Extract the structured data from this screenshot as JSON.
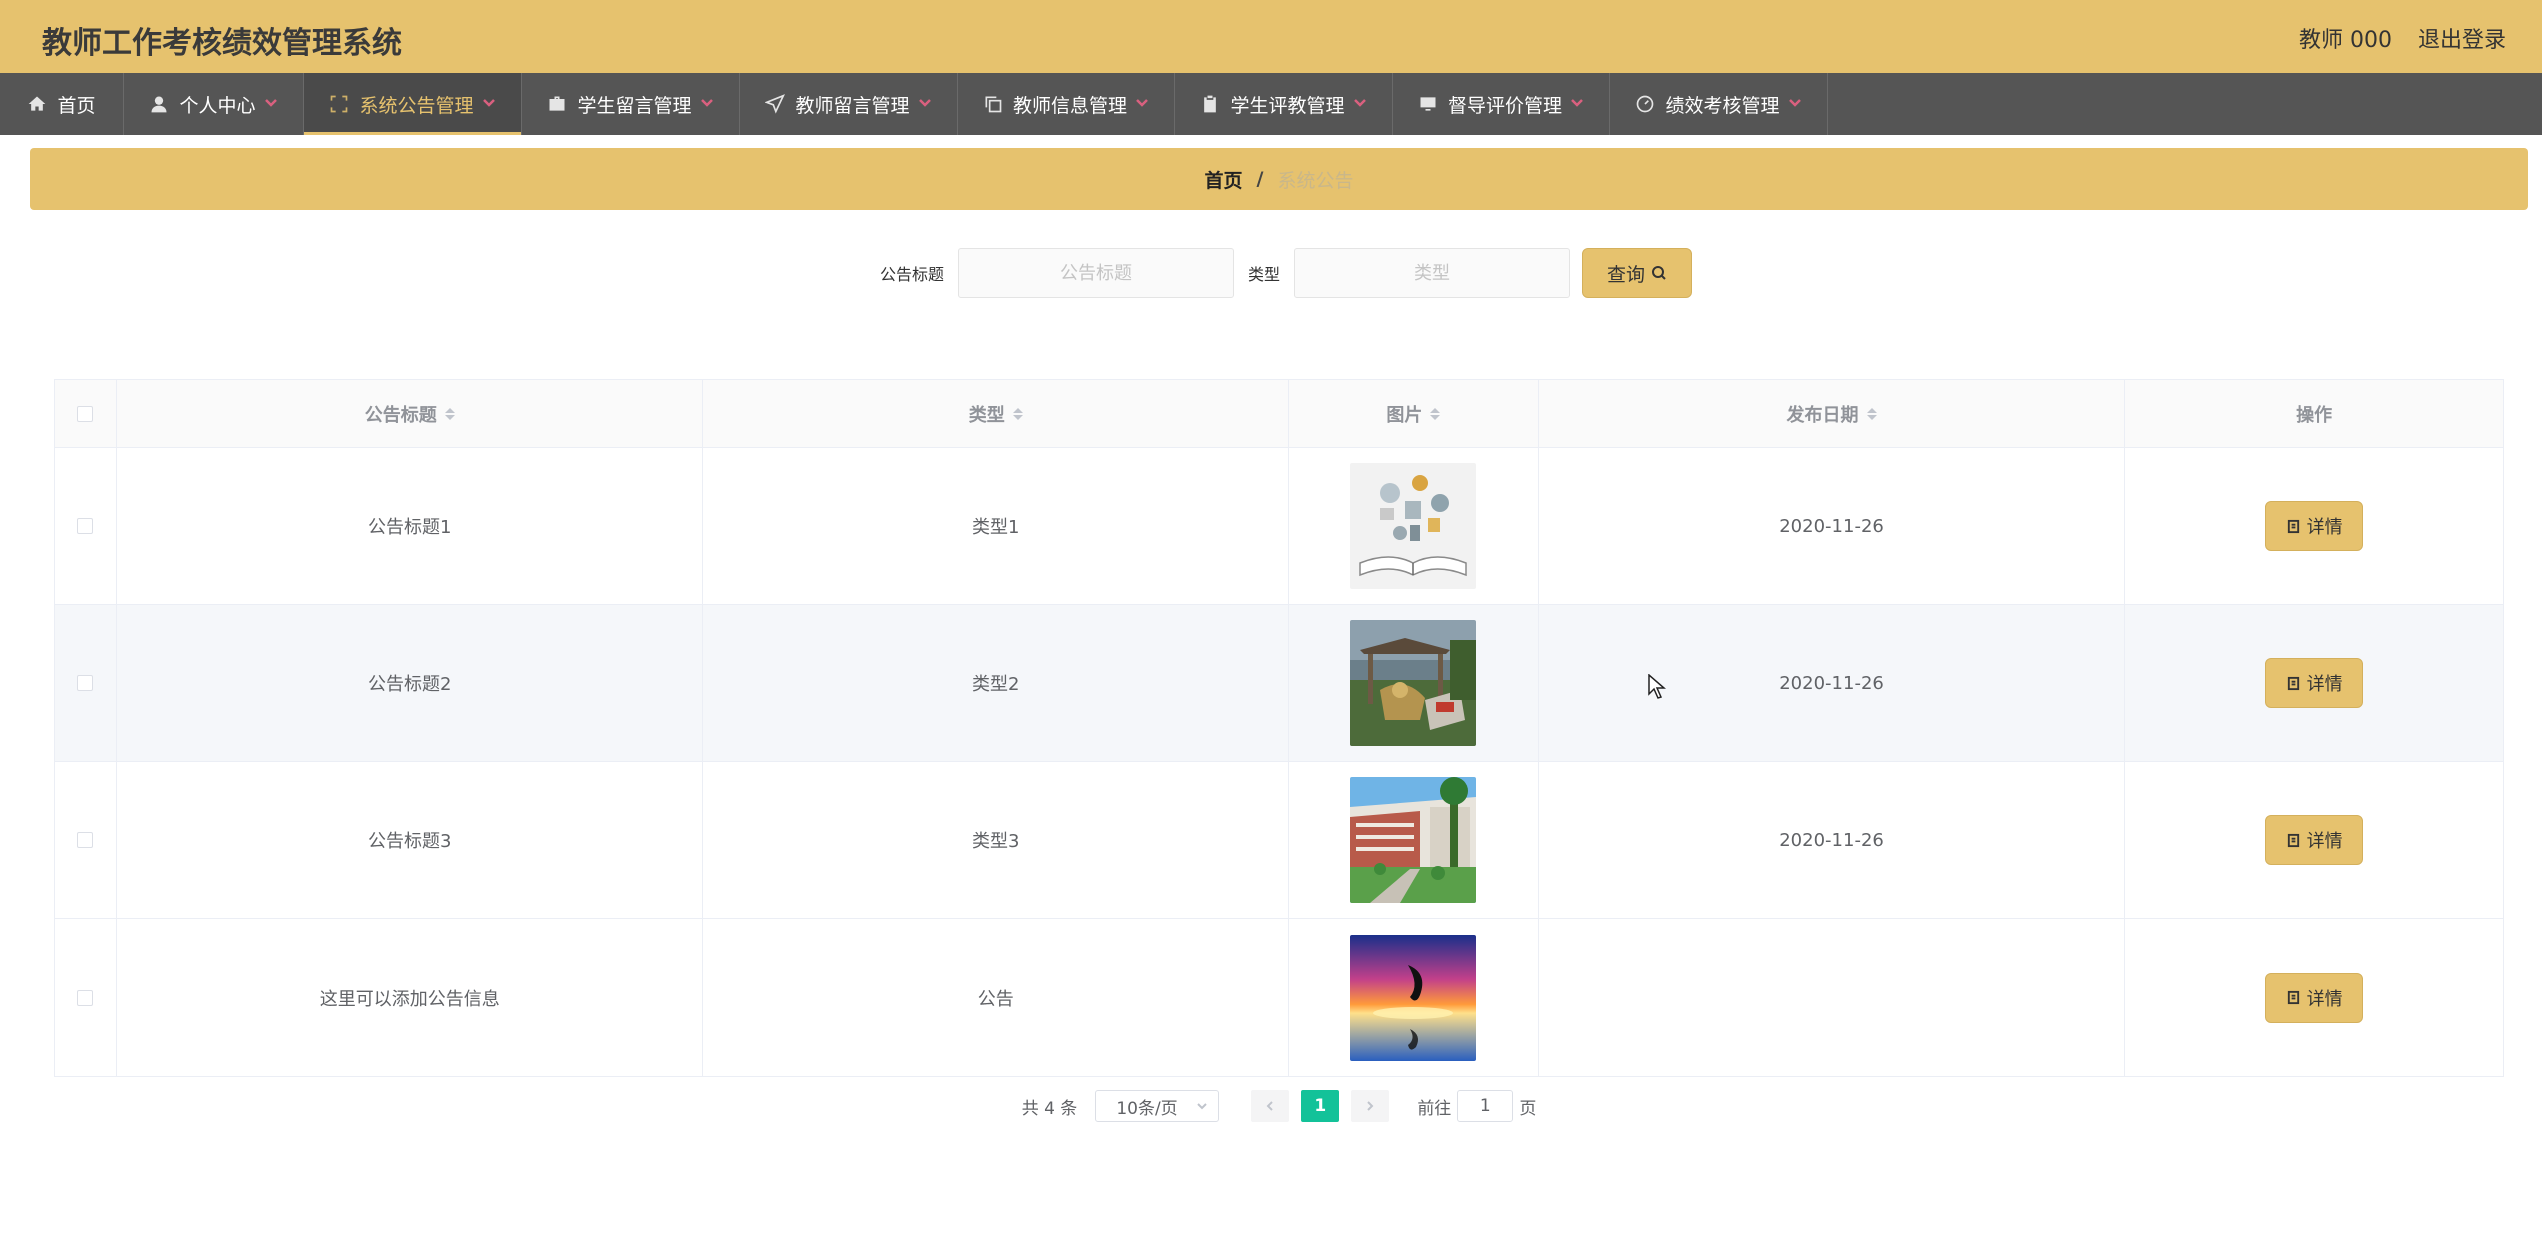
{
  "header": {
    "title": "教师工作考核绩效管理系统",
    "user": "教师 000",
    "logout": "退出登录"
  },
  "nav": [
    {
      "label": "首页",
      "icon": "home-icon",
      "has_dropdown": false,
      "active": false
    },
    {
      "label": "个人中心",
      "icon": "user-icon",
      "has_dropdown": true,
      "active": false
    },
    {
      "label": "系统公告管理",
      "icon": "fullscreen-icon",
      "has_dropdown": true,
      "active": true
    },
    {
      "label": "学生留言管理",
      "icon": "briefcase-icon",
      "has_dropdown": true,
      "active": false
    },
    {
      "label": "教师留言管理",
      "icon": "paper-plane-icon",
      "has_dropdown": true,
      "active": false
    },
    {
      "label": "教师信息管理",
      "icon": "copy-icon",
      "has_dropdown": true,
      "active": false
    },
    {
      "label": "学生评教管理",
      "icon": "clipboard-icon",
      "has_dropdown": true,
      "active": false
    },
    {
      "label": "督导评价管理",
      "icon": "monitor-icon",
      "has_dropdown": true,
      "active": false
    },
    {
      "label": "绩效考核管理",
      "icon": "gauge-icon",
      "has_dropdown": true,
      "active": false
    }
  ],
  "breadcrumb": {
    "home": "首页",
    "separator": "/",
    "current": "系统公告"
  },
  "search": {
    "title_label": "公告标题",
    "title_placeholder": "公告标题",
    "type_label": "类型",
    "type_placeholder": "类型",
    "button": "查询"
  },
  "table": {
    "columns": [
      "公告标题",
      "类型",
      "图片",
      "发布日期",
      "操作"
    ],
    "rows": [
      {
        "title": "公告标题1",
        "type": "类型1",
        "image": "book-illustration",
        "date": "2020-11-26",
        "action": "详情"
      },
      {
        "title": "公告标题2",
        "type": "类型2",
        "image": "campus-pavilion",
        "date": "2020-11-26",
        "action": "详情"
      },
      {
        "title": "公告标题3",
        "type": "类型3",
        "image": "school-building",
        "date": "2020-11-26",
        "action": "详情"
      },
      {
        "title": "这里可以添加公告信息",
        "type": "公告",
        "image": "dolphin-sunset",
        "date": "",
        "action": "详情"
      }
    ]
  },
  "pagination": {
    "total": "共 4 条",
    "page_size": "10条/页",
    "current": "1",
    "goto_prefix": "前往",
    "goto_value": "1",
    "goto_suffix": "页"
  },
  "colors": {
    "accent": "#e6c26e",
    "nav_bg": "#555555",
    "active_page": "#13c299",
    "dropdown_chevron": "#d9607f"
  }
}
